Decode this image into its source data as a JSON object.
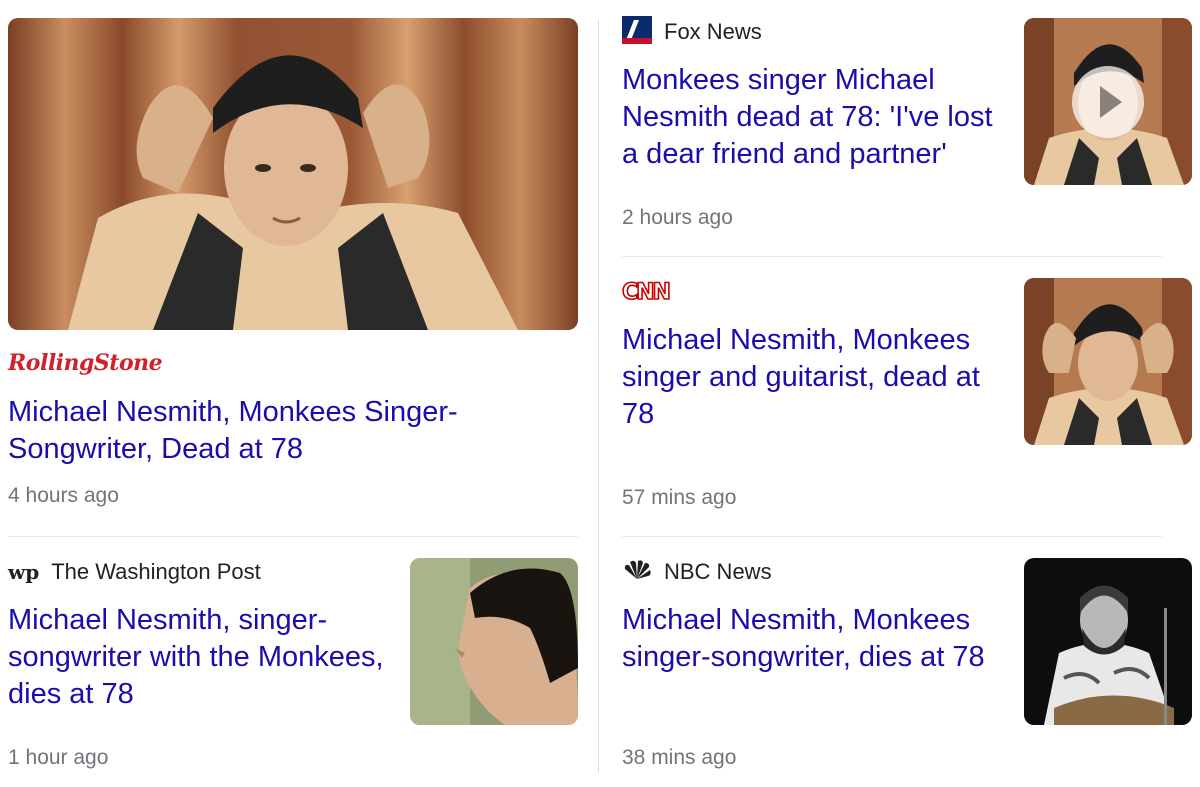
{
  "articles": [
    {
      "source": "Rolling Stone",
      "logo_text": "RollingStone",
      "headline": "Michael Nesmith, Monkees Singer-Songwriter, Dead at 78",
      "time": "4 hours ago"
    },
    {
      "source": "Fox News",
      "headline": "Monkees singer Michael Nesmith dead at 78: 'I've lost a dear friend and partner'",
      "time": "2 hours ago",
      "has_video": true
    },
    {
      "source": "CNN",
      "logo_text": "CNN",
      "headline": "Michael Nesmith, Monkees singer and guitarist, dead at 78",
      "time": "57 mins ago"
    },
    {
      "source": "The Washington Post",
      "logo_text": "wp",
      "headline": "Michael Nesmith, singer-songwriter with the Monkees, dies at 78",
      "time": "1 hour ago"
    },
    {
      "source": "NBC News",
      "headline": "Michael Nesmith, Monkees singer-songwriter, dies at 78",
      "time": "38 mins ago"
    }
  ],
  "colors": {
    "headline": "#1a0dab",
    "meta": "#70757a",
    "rolling_stone": "#d0222d",
    "cnn": "#cc0000"
  },
  "icons": {
    "fox": "fox-news-logo-icon",
    "nbc": "nbc-peacock-icon",
    "play": "play-icon"
  }
}
